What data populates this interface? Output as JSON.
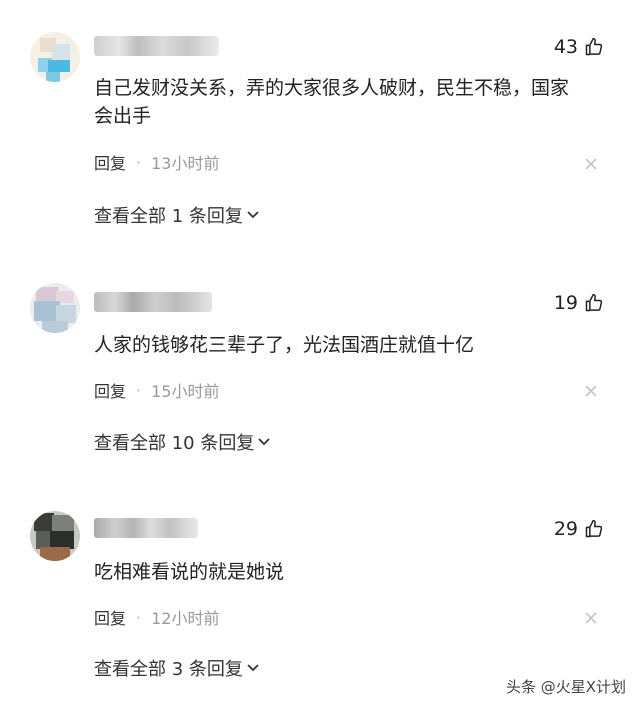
{
  "comments": [
    {
      "likes": "43",
      "text_line1": "自己发财没关系，弄的大家很多人破财，民生不稳，国家",
      "text_line2": "会出手",
      "reply_label": "回复",
      "separator": "·",
      "time": "13小时前",
      "view_replies": "查看全部 1 条回复"
    },
    {
      "likes": "19",
      "text_line1": "人家的钱够花三辈子了，光法国酒庄就值十亿",
      "reply_label": "回复",
      "separator": "·",
      "time": "15小时前",
      "view_replies": "查看全部 10 条回复"
    },
    {
      "likes": "29",
      "text_line1": "吃相难看说的就是她说",
      "reply_label": "回复",
      "separator": "·",
      "time": "12小时前",
      "view_replies": "查看全部 3 条回复"
    }
  ],
  "watermark": "头条 @火星X计划",
  "icons": {
    "like": "thumbs-up-icon",
    "close": "close-icon",
    "expand": "chevron-down-icon"
  },
  "colors": {
    "text": "#222222",
    "muted": "#9a9a9a",
    "close_icon": "#c4c4c4"
  }
}
